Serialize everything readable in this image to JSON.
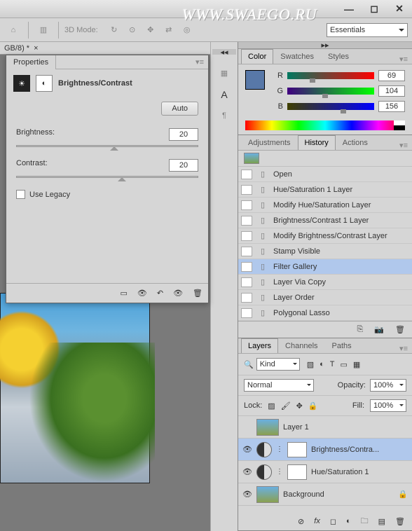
{
  "watermark": "WWW.SWAEGO.RU",
  "workspace": "Essentials",
  "toolbar": {
    "mode3d": "3D Mode:"
  },
  "doctab": {
    "name": "GB/8) *",
    "close": "×"
  },
  "properties": {
    "tab": "Properties",
    "title": "Brightness/Contrast",
    "auto": "Auto",
    "brightness_label": "Brightness:",
    "brightness_value": "20",
    "contrast_label": "Contrast:",
    "contrast_value": "20",
    "legacy": "Use Legacy"
  },
  "color": {
    "tabs": [
      "Color",
      "Swatches",
      "Styles"
    ],
    "r": {
      "label": "R",
      "value": "69"
    },
    "g": {
      "label": "G",
      "value": "104"
    },
    "b": {
      "label": "B",
      "value": "156"
    }
  },
  "history": {
    "tabs": [
      "Adjustments",
      "History",
      "Actions"
    ],
    "items": [
      {
        "label": "Open"
      },
      {
        "label": "Hue/Saturation 1 Layer"
      },
      {
        "label": "Modify Hue/Saturation Layer"
      },
      {
        "label": "Brightness/Contrast 1 Layer"
      },
      {
        "label": "Modify Brightness/Contrast Layer"
      },
      {
        "label": "Stamp Visible"
      },
      {
        "label": "Filter Gallery",
        "selected": true
      },
      {
        "label": "Layer Via Copy",
        "dim": true
      },
      {
        "label": "Layer Order",
        "dim": true
      },
      {
        "label": "Polygonal Lasso",
        "dim": true
      }
    ]
  },
  "layers": {
    "tabs": [
      "Layers",
      "Channels",
      "Paths"
    ],
    "kind": "Kind",
    "blend": "Normal",
    "opacity_label": "Opacity:",
    "opacity_value": "100%",
    "lock_label": "Lock:",
    "fill_label": "Fill:",
    "fill_value": "100%",
    "items": [
      {
        "name": "Layer 1",
        "type": "img",
        "visible": false
      },
      {
        "name": "Brightness/Contra...",
        "type": "adj",
        "visible": true,
        "selected": true
      },
      {
        "name": "Hue/Saturation 1",
        "type": "adj",
        "visible": true
      },
      {
        "name": "Background",
        "type": "img",
        "visible": true,
        "locked": true
      }
    ]
  }
}
